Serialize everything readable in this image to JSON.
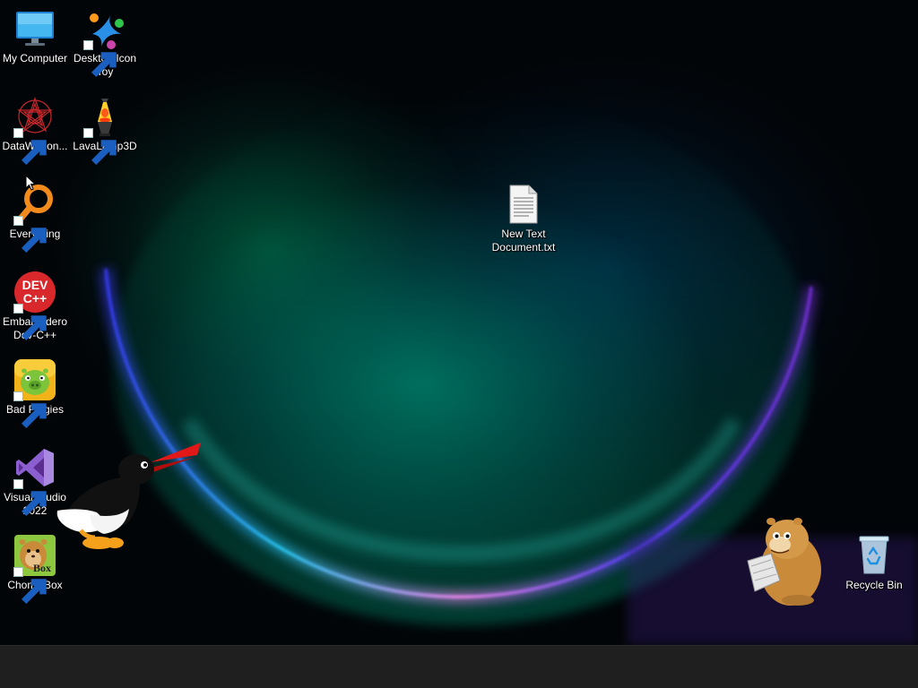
{
  "desktop": {
    "icons": [
      {
        "id": "my-computer",
        "label": "My Computer",
        "icon": "monitor-icon",
        "shortcut": false
      },
      {
        "id": "desktop-icon-toy",
        "label": "Desktop Icon Toy",
        "icon": "desktop-icon-toy-icon",
        "shortcut": true
      },
      {
        "id": "datawagon",
        "label": "DataWagon...",
        "icon": "datawagon-icon",
        "shortcut": true
      },
      {
        "id": "lavalamp3d",
        "label": "LavaLamp3D",
        "icon": "lava-lamp-icon",
        "shortcut": true
      },
      {
        "id": "everything",
        "label": "Everything",
        "icon": "magnifier-icon",
        "shortcut": true
      },
      {
        "id": "new-text-document",
        "label": "New Text Document.txt",
        "icon": "text-file-icon",
        "shortcut": false
      },
      {
        "id": "dev-cpp",
        "label": "Embarcadero Dev-C++",
        "icon": "dev-cpp-icon",
        "shortcut": true
      },
      {
        "id": "bad-piggies",
        "label": "Bad Piggies",
        "icon": "bad-piggies-icon",
        "shortcut": true
      },
      {
        "id": "visual-studio",
        "label": "Visual Studio 2022",
        "icon": "visual-studio-icon",
        "shortcut": true
      },
      {
        "id": "chomikbox",
        "label": "ChomikBox",
        "icon": "chomikbox-icon",
        "shortcut": true
      },
      {
        "id": "recycle-bin",
        "label": "Recycle Bin",
        "icon": "recycle-bin-icon",
        "shortcut": false
      }
    ],
    "dev_cpp_logo_text": [
      "DEV",
      "C++"
    ],
    "chomikbox_logo_text": "Box"
  },
  "mascots": [
    {
      "name": "penguin-mascot",
      "icon": "penguin-icon"
    },
    {
      "name": "hamster-mascot",
      "icon": "hamster-icon"
    }
  ],
  "colors": {
    "taskbar": "#1f1f1f",
    "label_text": "#ffffff",
    "dev_cpp_red": "#d8282c",
    "vs_purple": "#8c5fd0",
    "everything_orange": "#f28a1c",
    "penguin_beak": "#e01818"
  }
}
